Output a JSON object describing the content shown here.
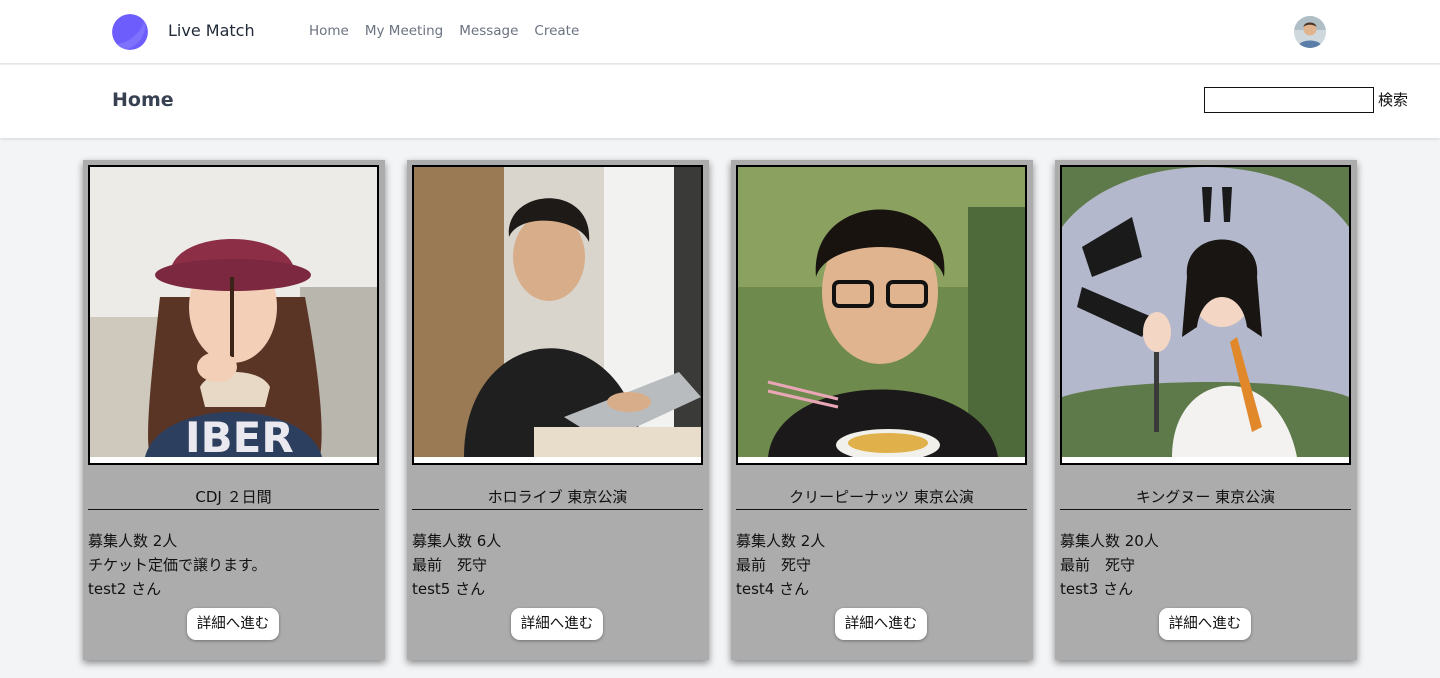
{
  "app": {
    "brand": "Live Match"
  },
  "nav": {
    "links": [
      {
        "label": "Home"
      },
      {
        "label": "My Meeting"
      },
      {
        "label": "Message"
      },
      {
        "label": "Create"
      }
    ]
  },
  "header": {
    "title": "Home"
  },
  "search": {
    "value": "",
    "placeholder": "",
    "button_label": "検索"
  },
  "cards": [
    {
      "title": "CDJ ２日間",
      "recruit": "募集人数 2人",
      "note": "チケット定価で譲ります。",
      "user": "test2 さん",
      "button": "詳細へ進む"
    },
    {
      "title": "ホロライブ 東京公演",
      "recruit": "募集人数 6人",
      "note": "最前　死守",
      "user": "test5 さん",
      "button": "詳細へ進む"
    },
    {
      "title": "クリーピーナッツ 東京公演",
      "recruit": "募集人数 2人",
      "note": "最前　死守",
      "user": "test4 さん",
      "button": "詳細へ進む"
    },
    {
      "title": "キングヌー 東京公演",
      "recruit": "募集人数 20人",
      "note": "最前　死守",
      "user": "test3 さん",
      "button": "詳細へ進む"
    }
  ],
  "colors": {
    "accent": "#6d5dfc",
    "card_bg": "#acacac",
    "nav_text": "#6b7280",
    "page_bg": "#f3f4f6"
  },
  "icons": {
    "logo": "crescent-logo-icon",
    "avatar": "user-avatar"
  }
}
